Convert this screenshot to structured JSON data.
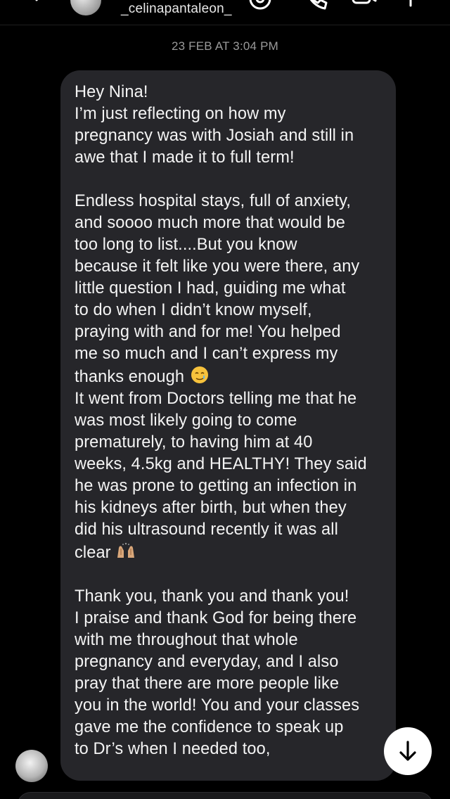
{
  "header": {
    "username": "_celinapantaleon_",
    "back_icon": "chevron-left-icon",
    "icons": [
      "call-icon",
      "video-icon",
      "more-icon"
    ]
  },
  "thread": {
    "timestamp": "23 FEB AT 3:04 PM"
  },
  "message": {
    "p1": "Hey Nina!\nI’m just reflecting on how my\npregnancy was with Josiah and still in\nawe that I made it to full term!",
    "p2a": "Endless hospital stays, full of anxiety,\nand soooo much more that would be\ntoo long to list....But you know\nbecause it felt like you were there, any\nlittle question I had, guiding me what\nto do when I didn’t know myself,\npraying with and for me! You helped\nme so much and I can’t express my\nthanks enough",
    "emoji1": "smiling-face-with-tear-emoji",
    "p2b": "It went from Doctors telling me that he\nwas most likely going to come\nprematurely, to having him at 40\nweeks, 4.5kg and HEALTHY! They said\nhe was prone to getting an infection in\nhis kidneys after birth, but when they\ndid his ultrasound recently it was all\nclear",
    "emoji2": "raising-hands-emoji",
    "p3": "Thank you, thank you and thank you!\nI praise and thank God for being there\nwith me throughout that whole\npregnancy and everyday, and I also\npray that there are more people like\nyou in the world! You and your classes\ngave me the confidence to speak up\nto Dr’s when I needed too,"
  },
  "scroll_button": {
    "icon": "arrow-down-icon"
  },
  "colors": {
    "background": "#000000",
    "bubble": "#26262a",
    "timestamp": "#9a9a9a",
    "text": "#f4f4f4"
  }
}
